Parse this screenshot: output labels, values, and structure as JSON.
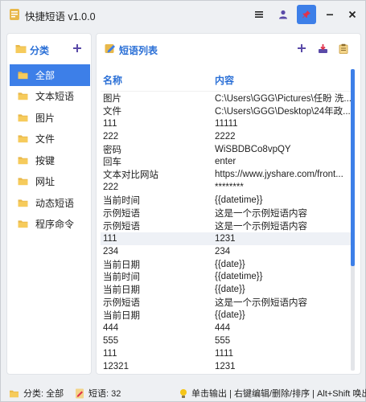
{
  "window": {
    "title": "快捷短语 v1.0.0",
    "accent": "#3d7fe8"
  },
  "titlebar": {
    "menu_icon": "menu-icon",
    "user_icon": "user-icon",
    "pin_icon": "pin-icon",
    "minimize_icon": "minimize-icon",
    "close_icon": "close-icon"
  },
  "categories_panel": {
    "title": "分类",
    "add_icon": "plus-icon",
    "items": [
      {
        "label": "全部",
        "selected": true
      },
      {
        "label": "文本短语"
      },
      {
        "label": "图片"
      },
      {
        "label": "文件"
      },
      {
        "label": "按键"
      },
      {
        "label": "网址"
      },
      {
        "label": "动态短语"
      },
      {
        "label": "程序命令"
      }
    ]
  },
  "phrases_panel": {
    "title": "短语列表",
    "add_icon": "plus-icon",
    "import_icon": "import-icon",
    "clipboard_icon": "clipboard-icon",
    "columns": {
      "name": "名称",
      "content": "内容"
    },
    "rows": [
      {
        "name": "图片",
        "content": "C:\\Users\\GGG\\Pictures\\任盼 洗..."
      },
      {
        "name": "文件",
        "content": "C:\\Users\\GGG\\Desktop\\24年政..."
      },
      {
        "name": "111",
        "content": "11111"
      },
      {
        "name": "222",
        "content": "2222"
      },
      {
        "name": "密码",
        "content": "WiSBDBCo8vpQY"
      },
      {
        "name": "回车",
        "content": "enter"
      },
      {
        "name": "文本对比网站",
        "content": "https://www.jyshare.com/front..."
      },
      {
        "name": "222",
        "content": "********"
      },
      {
        "name": "当前时间",
        "content": "{{datetime}}"
      },
      {
        "name": "示例短语",
        "content": "这是一个示例短语内容"
      },
      {
        "name": "示例短语",
        "content": "这是一个示例短语内容"
      },
      {
        "name": "111",
        "content": "1231",
        "highlighted": true
      },
      {
        "name": "234",
        "content": "234"
      },
      {
        "name": "当前日期",
        "content": "{{date}}"
      },
      {
        "name": "当前时间",
        "content": "{{datetime}}"
      },
      {
        "name": "当前日期",
        "content": "{{date}}"
      },
      {
        "name": "示例短语",
        "content": "这是一个示例短语内容"
      },
      {
        "name": "当前日期",
        "content": "{{date}}"
      },
      {
        "name": "444",
        "content": "444"
      },
      {
        "name": "555",
        "content": "555"
      },
      {
        "name": "111",
        "content": "1111"
      },
      {
        "name": "12321",
        "content": "1231"
      }
    ]
  },
  "statusbar": {
    "category": "分类: 全部",
    "count": "短语: 32",
    "hint": "单击输出 | 右键编辑/删除/排序 | Alt+Shift 唤出"
  }
}
